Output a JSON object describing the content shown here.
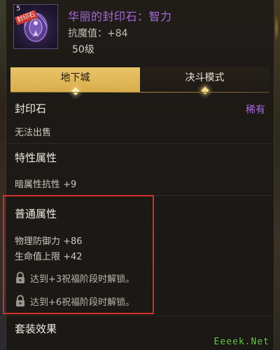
{
  "item": {
    "icon_number": "5",
    "icon_tag": "封印石",
    "title": "华丽的封印石：智力",
    "resist": "抗魔值：+84",
    "level": "50级"
  },
  "tabs": [
    {
      "label": "地下城",
      "active": true
    },
    {
      "label": "决斗模式",
      "active": false
    }
  ],
  "seal": {
    "title": "封印石",
    "rarity": "稀有",
    "sale_status": "无法出售"
  },
  "special": {
    "title": "特性属性",
    "stat": "暗属性抗性 +9"
  },
  "normal": {
    "title": "普通属性",
    "stats": [
      "物理防御力 +86",
      "生命值上限 +42"
    ],
    "locks": [
      "达到+3祝福阶段时解锁。",
      "达到+6祝福阶段时解锁。"
    ]
  },
  "set": {
    "title": "套装效果"
  },
  "watermark": "Eeeek.Net",
  "colors": {
    "rare_purple": "#a86adc",
    "active_tab_gold": "#e9c46a",
    "highlight_red": "#d0302a"
  }
}
